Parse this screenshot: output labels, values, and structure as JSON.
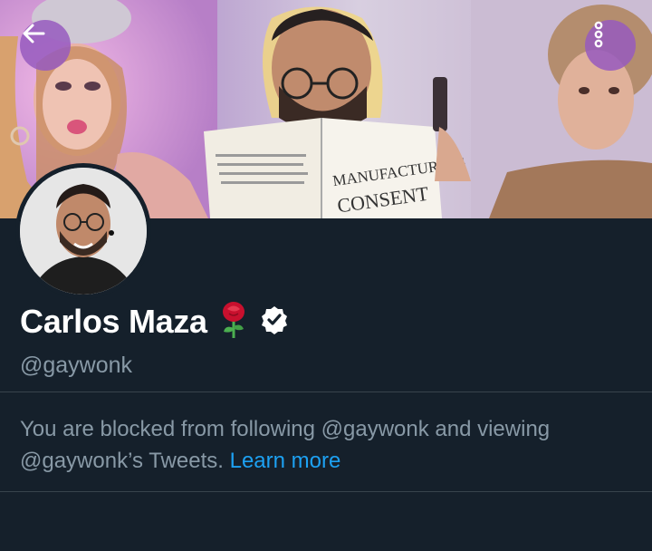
{
  "header": {
    "back_icon": "arrow-left-icon",
    "more_icon": "more-vertical-icon",
    "banner_book_text": "MANUFACTURING CONSENT"
  },
  "profile": {
    "name": "Carlos Maza",
    "name_emoji": "🌹",
    "verified": true,
    "handle": "@gaywonk"
  },
  "blocked_notice": {
    "text": "You are blocked from following @gaywonk and viewing @gaywonk’s Tweets.",
    "link_label": "Learn more"
  },
  "colors": {
    "background": "#15202b",
    "divider": "#38444d",
    "secondary_text": "#8899a6",
    "link": "#1da1f2",
    "overlay_button": "#965abe"
  }
}
